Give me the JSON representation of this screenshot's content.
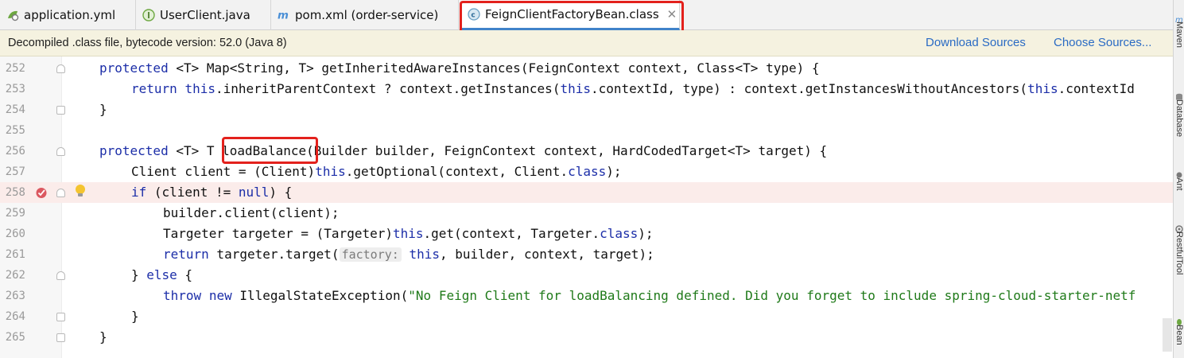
{
  "tabs": [
    {
      "label": "application.yml",
      "icon": "yaml-file-icon"
    },
    {
      "label": "UserClient.java",
      "icon": "interface-file-icon"
    },
    {
      "label": "pom.xml (order-service)",
      "icon": "maven-file-icon"
    },
    {
      "label": "FeignClientFactoryBean.class",
      "icon": "class-file-icon",
      "active": true
    }
  ],
  "close_glyph": "✕",
  "banner": {
    "message": "Decompiled .class file, bytecode version: 52.0 (Java 8)",
    "download_sources": "Download Sources",
    "choose_sources": "Choose Sources..."
  },
  "editor": {
    "highlight_line": "258",
    "lines": [
      {
        "num": "252"
      },
      {
        "num": "253"
      },
      {
        "num": "254"
      },
      {
        "num": "255"
      },
      {
        "num": "256"
      },
      {
        "num": "257"
      },
      {
        "num": "258"
      },
      {
        "num": "259"
      },
      {
        "num": "260"
      },
      {
        "num": "261"
      },
      {
        "num": "262"
      },
      {
        "num": "263"
      },
      {
        "num": "264"
      },
      {
        "num": "265"
      }
    ],
    "tokens": {
      "l252_kw": "protected",
      "l252_rest": " <T> Map<String, T> getInheritedAwareInstances(FeignContext context, Class<T> type) {",
      "l253_kw": "return",
      "l253_this1": "this",
      "l253_mid": ".inheritParentContext ? context.getInstances(",
      "l253_this2": "this",
      "l253_mid2": ".contextId, type) : context.getInstancesWithoutAncestors(",
      "l253_this3": "this",
      "l253_end": ".contextId",
      "l254": "}",
      "l256_kw": "protected",
      "l256_pre": " <T> T ",
      "l256_method": "loadBalance",
      "l256_rest": "(Builder builder, FeignContext context, HardCodedTarget<T> target) {",
      "l257_pre": "Client client = (Client)",
      "l257_this": "this",
      "l257_mid": ".getOptional(context, Client.",
      "l257_class": "class",
      "l257_end": ");",
      "l258_if": "if",
      "l258_mid": " (client != ",
      "l258_null": "null",
      "l258_end": ") {",
      "l259": "builder.client(client);",
      "l260_pre": "Targeter targeter = (Targeter)",
      "l260_this": "this",
      "l260_mid": ".get(context, Targeter.",
      "l260_class": "class",
      "l260_end": ");",
      "l261_kw": "return",
      "l261_pre": " targeter.target(",
      "l261_hint": "factory:",
      "l261_this": "this",
      "l261_end": ", builder, context, target);",
      "l262_pre": "} ",
      "l262_else": "else",
      "l262_end": " {",
      "l263_throw": "throw",
      "l263_new": "new",
      "l263_pre": " IllegalStateException(",
      "l263_str": "\"No Feign Client for loadBalancing defined. Did you forget to include spring-cloud-starter-netf",
      "l264": "}",
      "l265": "}"
    }
  },
  "right_tools": [
    {
      "label": "Maven",
      "icon": "maven-icon"
    },
    {
      "label": "Database",
      "icon": "database-icon"
    },
    {
      "label": "Ant",
      "icon": "ant-icon"
    },
    {
      "label": "RestfulTool",
      "icon": "restful-tool-icon"
    },
    {
      "label": "Bean",
      "icon": "bean-icon"
    }
  ],
  "colors": {
    "keyword": "#1c2ea8",
    "string": "#1f7a19",
    "link": "#2a6bc4",
    "annotation_box": "#e3211c",
    "breakpoint_line": "#fbecea"
  }
}
